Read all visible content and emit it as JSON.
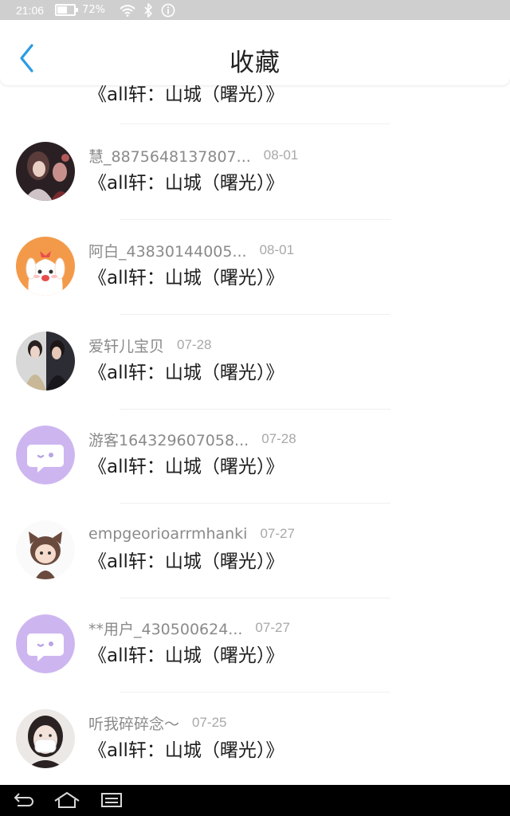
{
  "status_bar": {
    "time": "21:06",
    "battery": "72%",
    "battery_level": 0.72
  },
  "header": {
    "title": "收藏"
  },
  "icons": {
    "back": "chevron-left-icon",
    "wifi": "wifi-icon",
    "bluetooth": "bluetooth-icon",
    "info": "info-icon",
    "nav_back": "back-arrow-icon",
    "nav_home": "home-icon",
    "nav_recent": "recent-apps-icon"
  },
  "colors": {
    "accent": "#2b9be3",
    "avatar_default": "#cdb6f0"
  },
  "items": [
    {
      "user": "",
      "date": "",
      "title": "《all轩：山城（曙光）》",
      "avatar": "default"
    },
    {
      "user": "慧_8875648137807...",
      "date": "08-01",
      "title": "《all轩：山城（曙光）》",
      "avatar": "photo-dark"
    },
    {
      "user": "阿白_43830144005...",
      "date": "08-01",
      "title": "《all轩：山城（曙光）》",
      "avatar": "cartoon-puppy"
    },
    {
      "user": "爱轩儿宝贝",
      "date": "07-28",
      "title": "《all轩：山城（曙光）》",
      "avatar": "photo-duo"
    },
    {
      "user": "游客164329607058...",
      "date": "07-28",
      "title": "《all轩：山城（曙光）》",
      "avatar": "default"
    },
    {
      "user": "empgeorioarrmhanki",
      "date": "07-27",
      "title": "《all轩：山城（曙光）》",
      "avatar": "cartoon-cat"
    },
    {
      "user": "**用户_430500624...",
      "date": "07-27",
      "title": "《all轩：山城（曙光）》",
      "avatar": "default"
    },
    {
      "user": "听我碎碎念～",
      "date": "07-25",
      "title": "《all轩：山城（曙光）》",
      "avatar": "photo-mask"
    }
  ]
}
